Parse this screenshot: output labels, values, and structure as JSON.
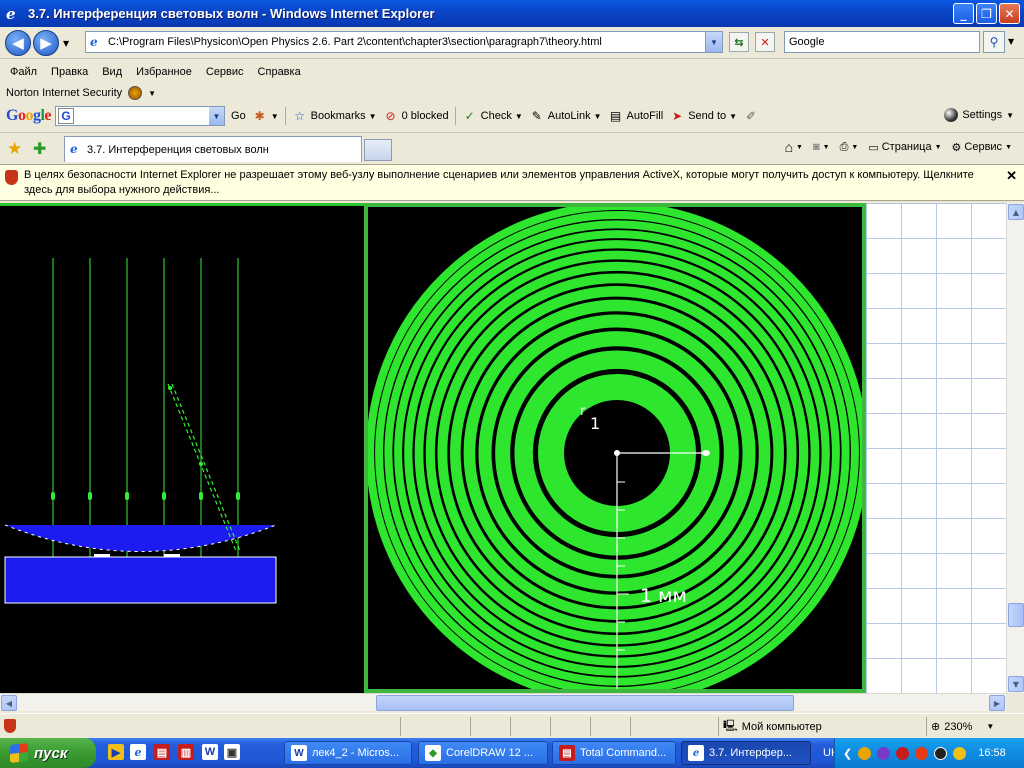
{
  "window": {
    "title": "3.7. Интерференция световых волн - Windows Internet Explorer"
  },
  "address": {
    "url": "C:\\Program Files\\Physicon\\Open Physics 2.6. Part 2\\content\\chapter3\\section\\paragraph7\\theory.html",
    "search_value": "Google"
  },
  "menu": [
    "Файл",
    "Правка",
    "Вид",
    "Избранное",
    "Сервис",
    "Справка"
  ],
  "norton": {
    "label": "Norton Internet Security"
  },
  "google_toolbar": {
    "go": "Go",
    "bookmarks": "Bookmarks",
    "blocked": "0 blocked",
    "check": "Check",
    "autolink": "AutoLink",
    "autofill": "AutoFill",
    "sendto": "Send to",
    "settings": "Settings"
  },
  "tab": {
    "title": "3.7. Интерференция световых волн"
  },
  "commandbar": {
    "page": "Страница",
    "tools": "Сервис"
  },
  "infobar": {
    "text": "В целях безопасности Internet Explorer не разрешает этому веб-узлу выполнение сценариев или элементов управления ActiveX, которые могут получить доступ к компьютеру. Щелкните здесь для выбора нужного действия..."
  },
  "simulation": {
    "radius_label": "r",
    "radius_sub": "1",
    "scale_label": "1 мм",
    "ring_color": "#33ff33"
  },
  "status": {
    "zone": "Мой компьютер",
    "zoom": "230%"
  },
  "taskbar": {
    "start": "пуск",
    "tasks": [
      "лек4_2 - Micros...",
      "CorelDRAW 12 ...",
      "Total Command...",
      "3.7. Интерфер..."
    ],
    "lang": "UK",
    "clock": "16:58"
  }
}
